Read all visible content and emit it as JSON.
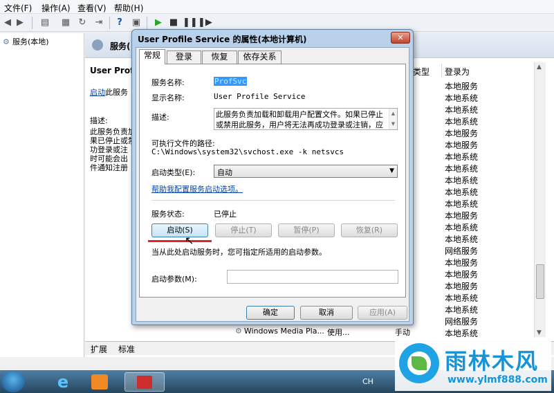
{
  "menu": {
    "file": "文件(F)",
    "action": "操作(A)",
    "view": "查看(V)",
    "help": "帮助(H)"
  },
  "tree": {
    "item": "服务(本地)"
  },
  "main": {
    "header_title": "服务(",
    "desc_title": "User Profil",
    "desc_link": "启动",
    "desc_link_suffix": "此服务",
    "desc_label": "描述:",
    "desc_lines": [
      "此服务负责加",
      "果已停止或禁",
      "功登录或注",
      "时可能会出",
      "件通知注册"
    ],
    "col_type": "类型",
    "col_login": "登录为",
    "login_values": [
      "本地服务",
      "本地系统",
      "本地系统",
      "本地系统",
      "本地服务",
      "本地服务",
      "本地系统",
      "本地系统",
      "本地系统",
      "本地系统",
      "本地系统",
      "本地服务",
      "本地系统",
      "本地系统",
      "网络服务",
      "本地服务",
      "本地服务",
      "本地服务",
      "本地系统",
      "本地系统",
      "网络服务",
      "本地系统"
    ],
    "partial_row": {
      "name": "Windows Media Pla...",
      "type": "使用...",
      "col": "手动"
    }
  },
  "bottom_tabs": {
    "extended": "扩展",
    "standard": "标准"
  },
  "taskbar": {
    "ime": "CH"
  },
  "watermark": {
    "title": "雨林木风",
    "url": "www.ylmf888.com"
  },
  "dialog": {
    "title": "User Profile Service 的属性(本地计算机)",
    "close_label": "✕",
    "tabs": [
      "常规",
      "登录",
      "恢复",
      "依存关系"
    ],
    "service_name_label": "服务名称:",
    "service_name": "ProfSvc",
    "display_name_label": "显示名称:",
    "display_name": "User Profile Service",
    "description_label": "描述:",
    "description": "此服务负责加载和卸载用户配置文件。如果已停止或禁用此服务，用户将无法再成功登录或注销，应用程序在获取用户数据时可能会出现问题，而且注册接收配置文件事件通知的组件将无法接收这些通知。",
    "exe_path_label": "可执行文件的路径:",
    "exe_path": "C:\\Windows\\system32\\svchost.exe -k netsvcs",
    "startup_type_label": "启动类型(E):",
    "startup_type": "自动",
    "help_link": "帮助我配置服务启动选项。",
    "status_label": "服务状态:",
    "status_value": "已停止",
    "btn_start": "启动(S)",
    "btn_stop": "停止(T)",
    "btn_pause": "暂停(P)",
    "btn_resume": "恢复(R)",
    "start_hint": "当从此处启动服务时，您可指定所适用的启动参数。",
    "param_label": "启动参数(M):",
    "param_value": "",
    "btn_ok": "确定",
    "btn_cancel": "取消",
    "btn_apply": "应用(A)"
  }
}
